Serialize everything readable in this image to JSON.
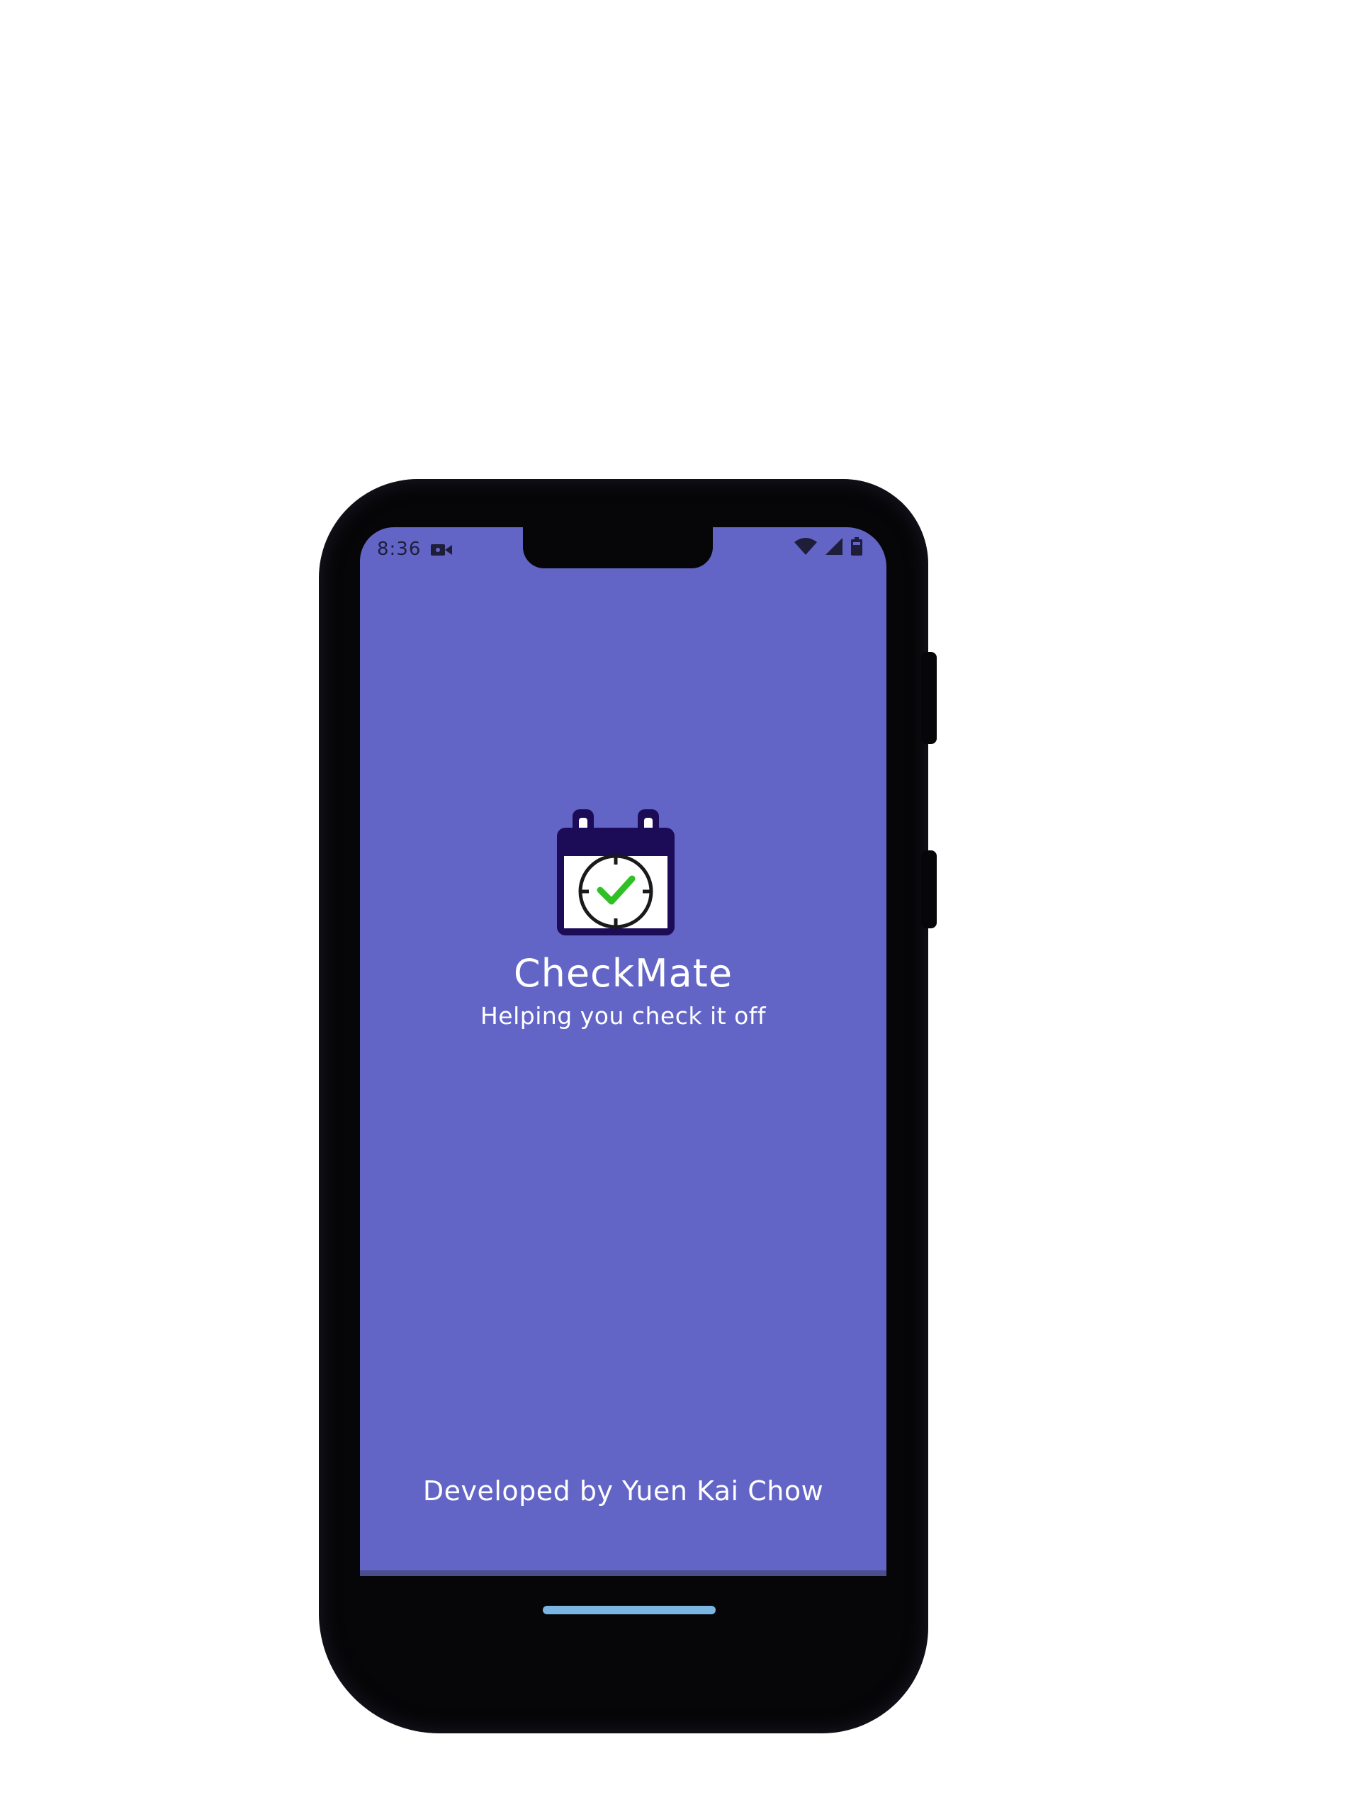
{
  "status_bar": {
    "time": "8:36",
    "icons": [
      "video-camera-icon",
      "wifi-icon",
      "signal-icon",
      "battery-icon"
    ]
  },
  "app": {
    "title": "CheckMate",
    "tagline": "Helping you check it off",
    "developer": "Developed by Yuen Kai Chow",
    "logo_icon": "calendar-clock-check-icon"
  },
  "colors": {
    "screen_background": "#6265c6",
    "logo_dark": "#1c0b56",
    "check_green": "#2fc026",
    "home_indicator": "#7bb6e3",
    "phone_body": "#060608"
  }
}
